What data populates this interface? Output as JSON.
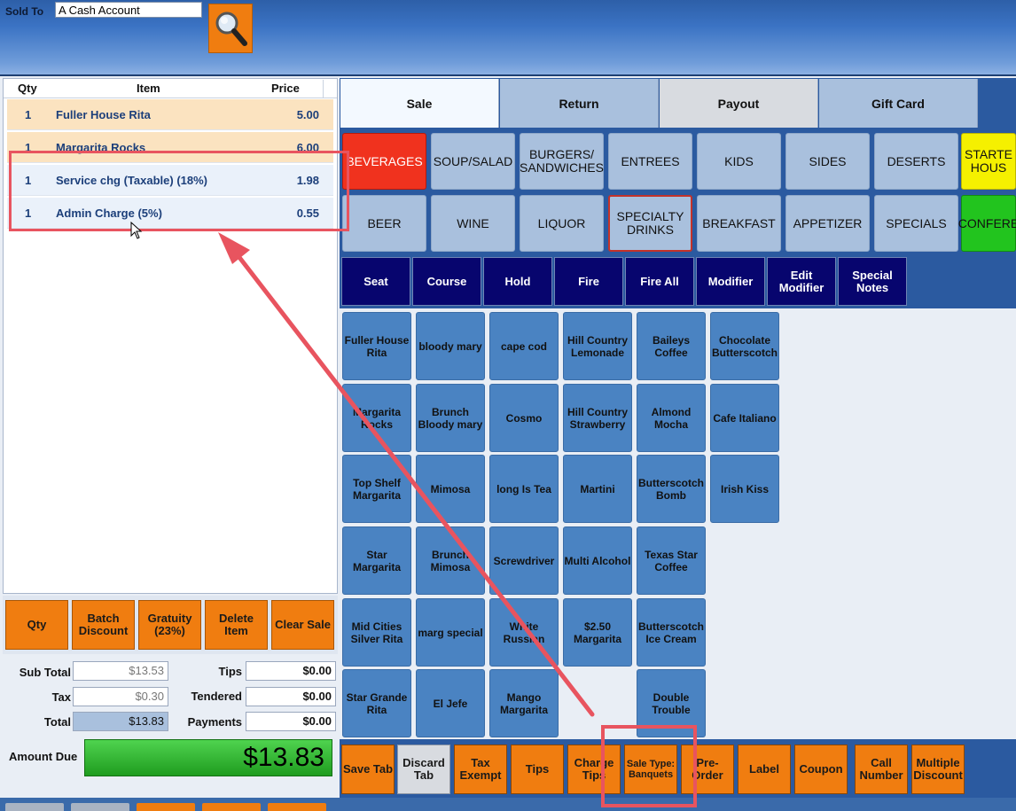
{
  "header": {
    "sold_to_label": "Sold To",
    "sold_to_value": "A Cash Account",
    "search_icon": "magnifier-icon"
  },
  "order": {
    "columns": [
      "Qty",
      "Item",
      "Price"
    ],
    "rows": [
      {
        "qty": "1",
        "item": "Fuller House Rita",
        "price": "5.00"
      },
      {
        "qty": "1",
        "item": "Margarita Rocks",
        "price": "6.00"
      },
      {
        "qty": "1",
        "item": "Service chg (Taxable) (18%)",
        "price": "1.98"
      },
      {
        "qty": "1",
        "item": "Admin Charge (5%)",
        "price": "0.55"
      }
    ],
    "buttons": [
      "Qty",
      "Batch Discount",
      "Gratuity (23%)",
      "Delete Item",
      "Clear Sale"
    ]
  },
  "totals": {
    "sub_total_label": "Sub Total",
    "sub_total": "$13.53",
    "tax_label": "Tax",
    "tax": "$0.30",
    "total_label": "Total",
    "total": "$13.83",
    "tips_label": "Tips",
    "tips": "$0.00",
    "tendered_label": "Tendered",
    "tendered": "$0.00",
    "payments_label": "Payments",
    "payments": "$0.00",
    "amount_due_label": "Amount Due",
    "amount_due": "$13.83"
  },
  "tabs": [
    "Sale",
    "Return",
    "Payout",
    "Gift Card"
  ],
  "categories_row1": [
    "BEVERAGES",
    "SOUP/SALAD",
    "BURGERS/ SANDWICHES",
    "ENTREES",
    "KIDS",
    "SIDES",
    "DESERTS",
    "STARTE HOUS"
  ],
  "categories_row2": [
    "BEER",
    "WINE",
    "LIQUOR",
    "SPECIALTY DRINKS",
    "BREAKFAST",
    "APPETIZER",
    "SPECIALS",
    "CONFERE"
  ],
  "functions": [
    "Seat",
    "Course",
    "Hold",
    "Fire",
    "Fire All",
    "Modifier",
    "Edit Modifier",
    "Special Notes"
  ],
  "items": [
    [
      "Fuller House Rita",
      "bloody mary",
      "cape cod",
      "Hill Country Lemonade",
      "Baileys Coffee",
      "Chocolate Butterscotch"
    ],
    [
      "Margarita Rocks",
      "Brunch Bloody mary",
      "Cosmo",
      "Hill Country Strawberry",
      "Almond Mocha",
      "Cafe Italiano"
    ],
    [
      "Top Shelf Margarita",
      "Mimosa",
      "long Is Tea",
      "Martini",
      "Butterscotch Bomb",
      "Irish Kiss"
    ],
    [
      "Star Margarita",
      "Brunch Mimosa",
      "Screwdriver",
      "Multi Alcohol",
      "Texas Star Coffee",
      ""
    ],
    [
      "Mid Cities Silver Rita",
      "marg special",
      "White Russian",
      "$2.50 Margarita",
      "Butterscotch Ice Cream",
      ""
    ],
    [
      "Star Grande Rita",
      "El Jefe",
      "Mango Margarita",
      "",
      "Double Trouble",
      ""
    ]
  ],
  "bottom_buttons": [
    "Save Tab",
    "Discard Tab",
    "Tax Exempt",
    "Tips",
    "Charge Tips",
    "Sale Type: Banquets",
    "Pre-Order",
    "Label",
    "Coupon",
    "Call Number",
    "Multiple Discount"
  ],
  "colors": {
    "orange": "#f07d10",
    "navy_func": "#07056e",
    "item_blue": "#4a83c2",
    "active_category": "#f0321e",
    "annotation": "#e8545f",
    "amount_green": "#2bb52b"
  }
}
